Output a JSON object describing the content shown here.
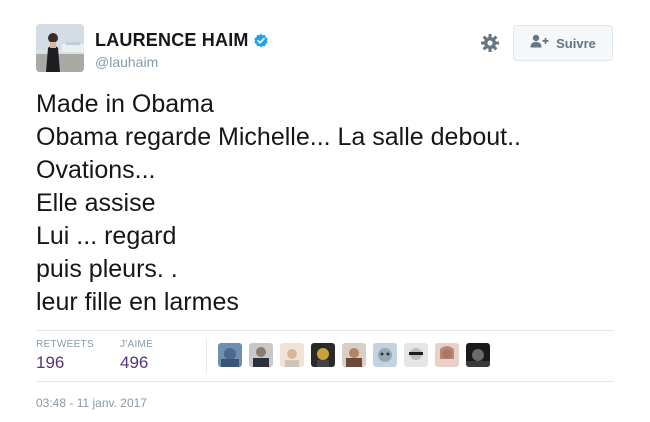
{
  "author": {
    "display_name": "LAURENCE HAIM",
    "username": "@lauhaim",
    "verified": true
  },
  "actions": {
    "follow_label": "Suivre"
  },
  "tweet": {
    "lines": [
      "Made in Obama",
      "Obama regarde Michelle... La salle debout..",
      "Ovations...",
      "Elle assise",
      "Lui ... regard",
      "puis pleurs. .",
      "leur fille en larmes"
    ]
  },
  "stats": {
    "retweets_label": "RETWEETS",
    "retweets_value": "196",
    "likes_label": "J'AIME",
    "likes_value": "496"
  },
  "timestamp": "03:48 - 11 janv. 2017",
  "colors": {
    "accent": "#1da1f2",
    "stat_value": "#55347a",
    "muted": "#8899a6",
    "text": "#14171a"
  }
}
